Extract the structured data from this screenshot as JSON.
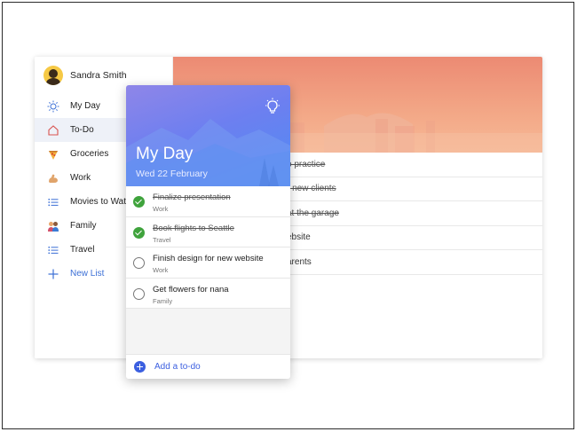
{
  "user": {
    "name": "Sandra Smith"
  },
  "sidebar": {
    "items": [
      {
        "label": "My Day",
        "icon": "sun-icon"
      },
      {
        "label": "To-Do",
        "icon": "home-icon",
        "active": true
      },
      {
        "label": "Groceries",
        "icon": "pizza-icon"
      },
      {
        "label": "Work",
        "icon": "flexed-arm-icon"
      },
      {
        "label": "Movies to Wat",
        "icon": "list-icon"
      },
      {
        "label": "Family",
        "icon": "family-icon"
      },
      {
        "label": "Travel",
        "icon": "list-icon"
      },
      {
        "label": "New List",
        "icon": "plus-icon"
      }
    ]
  },
  "back_list": {
    "rows": [
      {
        "text": "o practice",
        "done": true
      },
      {
        "text": "r new clients",
        "done": true
      },
      {
        "text": "at the garage",
        "done": true
      },
      {
        "text": "ebsite",
        "done": false
      },
      {
        "text": "arents",
        "done": false
      }
    ]
  },
  "my_day": {
    "title": "My Day",
    "date": "Wed 22 February",
    "tasks": [
      {
        "title": "Finalize presentation",
        "list": "Work",
        "done": true
      },
      {
        "title": "Book flights to Seattle",
        "list": "Travel",
        "done": true
      },
      {
        "title": "Finish design for new website",
        "list": "Work",
        "done": false
      },
      {
        "title": "Get flowers for nana",
        "list": "Family",
        "done": false
      }
    ],
    "add_label": "Add a to-do"
  },
  "colors": {
    "accent": "#3b5fe0",
    "done_green": "#3fa33c",
    "header_warm": "#ec8a73",
    "header_cool": "#6d7ff0"
  }
}
